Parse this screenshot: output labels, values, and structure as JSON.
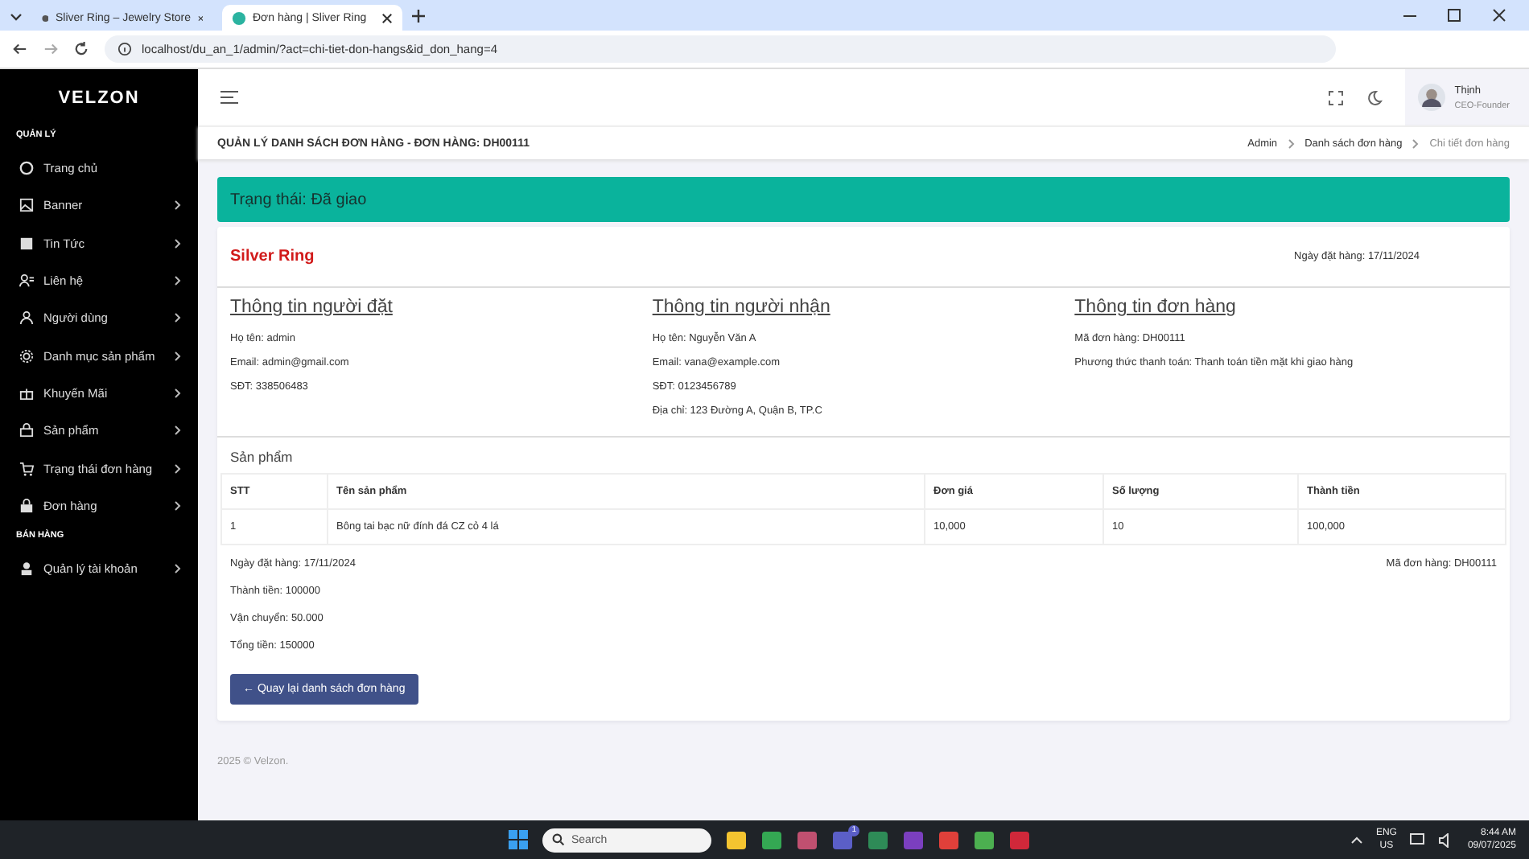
{
  "browser": {
    "tabs": [
      {
        "title": "Sliver Ring – Jewelry Store",
        "selected": false
      },
      {
        "title": "Đơn hàng | Sliver Ring",
        "selected": true
      }
    ],
    "url": "localhost/du_an_1/admin/?act=chi-tiet-don-hangs&id_don_hang=4"
  },
  "sidebar": {
    "logo": "VELZON",
    "sections": [
      {
        "title": "QUẢN LÝ",
        "items": [
          {
            "label": "Trang chủ",
            "expandable": false
          },
          {
            "label": "Banner",
            "expandable": true
          },
          {
            "label": "Tin Tức",
            "expandable": true
          },
          {
            "label": "Liên hệ",
            "expandable": true
          },
          {
            "label": "Người dùng",
            "expandable": true
          },
          {
            "label": "Danh mục sản phẩm",
            "expandable": true
          },
          {
            "label": "Khuyến Mãi",
            "expandable": true
          },
          {
            "label": "Sản phẩm",
            "expandable": true
          },
          {
            "label": "Trạng thái đơn hàng",
            "expandable": true
          },
          {
            "label": "Đơn hàng",
            "expandable": true
          }
        ]
      },
      {
        "title": "BÁN HÀNG",
        "items": [
          {
            "label": "Quản lý tài khoản",
            "expandable": true
          }
        ]
      }
    ]
  },
  "topbar": {
    "user": {
      "name": "Thịnh",
      "role": "CEO-Founder"
    }
  },
  "page_title": "QUẢN LÝ DANH SÁCH ĐƠN HÀNG - ĐƠN HÀNG: DH00111",
  "breadcrumbs": [
    {
      "label": "Admin",
      "active": false
    },
    {
      "label": "Danh sách đơn hàng",
      "active": false
    },
    {
      "label": "Chi tiết đơn hàng",
      "active": true
    }
  ],
  "status": "Trạng thái: Đã giao",
  "order": {
    "brand": "Silver Ring",
    "order_date": "Ngày đặt hàng: 17/11/2024",
    "sections": [
      {
        "title": "Thông tin người đặt",
        "lines": [
          "Họ tên: admin",
          "Email: admin@gmail.com",
          "SĐT: 338506483"
        ]
      },
      {
        "title": "Thông tin người nhận",
        "lines": [
          "Họ tên: Nguyễn Văn A",
          "Email: vana@example.com",
          "SĐT: 0123456789",
          "Địa chỉ: 123 Đường A, Quận B, TP.C"
        ]
      },
      {
        "title": "Thông tin đơn hàng",
        "lines": [
          "Mã đơn hàng: DH00111",
          "Phương thức thanh toán: Thanh toán tiền mặt khi giao hàng"
        ]
      }
    ],
    "products_title": "Sản phẩm",
    "table": {
      "columns": [
        "STT",
        "Tên sản phẩm",
        "Đơn giá",
        "Số lượng",
        "Thành tiền"
      ],
      "rows": [
        [
          "1",
          "Bông tai bạc nữ đính đá CZ cỏ 4 lá",
          "10,000",
          "10",
          "100,000"
        ]
      ]
    },
    "summary": [
      "Ngày đặt hàng: 17/11/2024",
      "Thành tiền: 100000",
      "Vận chuyển: 50.000",
      "Tổng tiền: 150000"
    ],
    "order_code": "Mã đơn hàng: DH00111",
    "back_button": "← Quay lại danh sách đơn hàng"
  },
  "footer": "2025 © Velzon.",
  "taskbar": {
    "search_placeholder": "Search",
    "apps": [
      {
        "kind": "folder"
      },
      {
        "kind": "chrome"
      },
      {
        "kind": "tool"
      },
      {
        "kind": "teams",
        "badge": "1"
      },
      {
        "kind": "hs"
      },
      {
        "kind": "vs"
      },
      {
        "kind": "remote"
      },
      {
        "kind": "sheet"
      },
      {
        "kind": "record"
      }
    ],
    "language": "ENG",
    "region": "US",
    "time": "8:44 AM",
    "date": "09/07/2025"
  }
}
